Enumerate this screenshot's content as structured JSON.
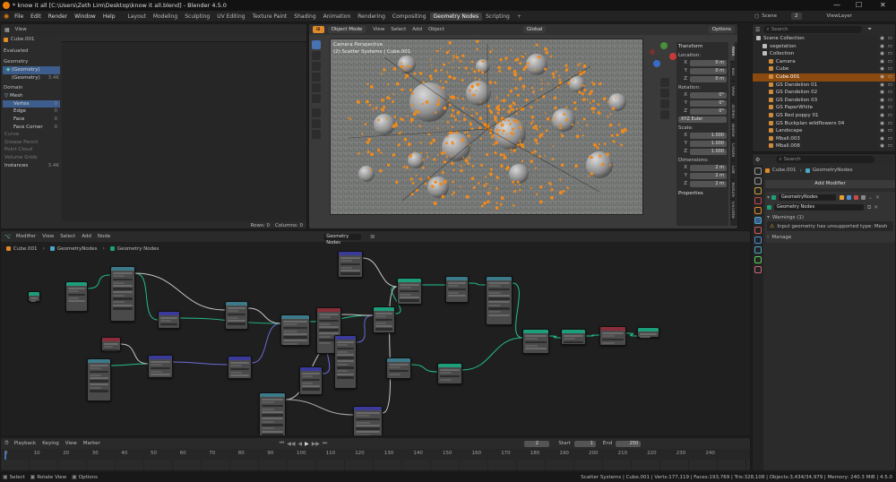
{
  "window": {
    "title": "* know it all [C:\\Users\\Zeth Lim\\Desktop\\know it all.blend] - Blender 4.5.0",
    "controls": [
      "—",
      "☐",
      "✕"
    ]
  },
  "menu": [
    "File",
    "Edit",
    "Render",
    "Window",
    "Help"
  ],
  "workspaces": [
    "Layout",
    "Modeling",
    "Sculpting",
    "UV Editing",
    "Texture Paint",
    "Shading",
    "Animation",
    "Rendering",
    "Compositing",
    "Geometry Nodes",
    "Scripting"
  ],
  "active_workspace": "Geometry Nodes",
  "scene": {
    "label": "Scene",
    "number": "2",
    "view_layer": "ViewLayer"
  },
  "spreadsheet": {
    "header": "View",
    "object": "Cube.001",
    "evaluated": "Evaluated",
    "geometry_heading": "Geometry",
    "geometry_items": [
      {
        "label": "(Geometry)",
        "count": ""
      },
      {
        "label": "(Geometry)",
        "count": "3.4K"
      }
    ],
    "domain_heading": "Domain",
    "mesh_label": "Mesh",
    "mesh_items": [
      {
        "label": "Vertex",
        "count": "0"
      },
      {
        "label": "Edge",
        "count": "0"
      },
      {
        "label": "Face",
        "count": "0"
      },
      {
        "label": "Face Corner",
        "count": "0"
      }
    ],
    "other_items": [
      {
        "label": "Curve",
        "count": ""
      },
      {
        "label": "Grease Pencil",
        "count": ""
      },
      {
        "label": "Point Cloud",
        "count": ""
      },
      {
        "label": "Volume Grids",
        "count": ""
      },
      {
        "label": "Instances",
        "count": "3.4K"
      }
    ],
    "rows": "Rows: 0",
    "columns": "Columns: 0"
  },
  "viewport": {
    "mode": "Object Mode",
    "menus": [
      "View",
      "Select",
      "Add",
      "Object"
    ],
    "orientation": "Global",
    "options": "Options",
    "overlay_title": "Camera Perspective",
    "overlay_sub": "(2) Scatter Systems | Cube.001",
    "transform": {
      "title": "Transform",
      "location": "Location:",
      "loc": [
        {
          "axis": "X",
          "value": "0 m"
        },
        {
          "axis": "Y",
          "value": "0 m"
        },
        {
          "axis": "Z",
          "value": "0 m"
        }
      ],
      "rotation": "Rotation:",
      "rot": [
        {
          "axis": "X",
          "value": "0°"
        },
        {
          "axis": "Y",
          "value": "0°"
        },
        {
          "axis": "Z",
          "value": "0°"
        }
      ],
      "euler": "XYZ Euler",
      "scale": "Scale:",
      "scl": [
        {
          "axis": "X",
          "value": "1.000"
        },
        {
          "axis": "Y",
          "value": "1.000"
        },
        {
          "axis": "Z",
          "value": "1.000"
        }
      ],
      "dimensions": "Dimensions:",
      "dim": [
        {
          "axis": "X",
          "value": "2 m"
        },
        {
          "axis": "Y",
          "value": "2 m"
        },
        {
          "axis": "Z",
          "value": "2 m"
        }
      ],
      "properties": "Properties"
    },
    "side_tabs": [
      "Item",
      "Tool",
      "View",
      "3Dfiles",
      "Biome",
      "Create",
      "Edit",
      "Texture",
      "GScatter"
    ]
  },
  "outliner": {
    "search_placeholder": "Search",
    "rows": [
      {
        "label": "Scene Collection",
        "indent": 0,
        "color": "#bdbdbd",
        "active": false
      },
      {
        "label": "vegetation",
        "indent": 1,
        "color": "#bdbdbd",
        "active": false
      },
      {
        "label": "Collection",
        "indent": 1,
        "color": "#bdbdbd",
        "active": false
      },
      {
        "label": "Camera",
        "indent": 2,
        "color": "#d08a3c",
        "active": false
      },
      {
        "label": "Cube",
        "indent": 2,
        "color": "#d08a3c",
        "active": false
      },
      {
        "label": "Cube.001",
        "indent": 2,
        "color": "#d08a3c",
        "active": true
      },
      {
        "label": "GS Dandelion 01",
        "indent": 2,
        "color": "#d08a3c",
        "active": false
      },
      {
        "label": "GS Dandelion 02",
        "indent": 2,
        "color": "#d08a3c",
        "active": false
      },
      {
        "label": "GS Dandelion 03",
        "indent": 2,
        "color": "#d08a3c",
        "active": false
      },
      {
        "label": "GS PaperWhite",
        "indent": 2,
        "color": "#d08a3c",
        "active": false
      },
      {
        "label": "GS Red poppy 01",
        "indent": 2,
        "color": "#d08a3c",
        "active": false
      },
      {
        "label": "GS Buckplan wildflowers 04",
        "indent": 2,
        "color": "#d08a3c",
        "active": false
      },
      {
        "label": "Landscape",
        "indent": 2,
        "color": "#d08a3c",
        "active": false
      },
      {
        "label": "Mball.003",
        "indent": 2,
        "color": "#d08a3c",
        "active": false
      },
      {
        "label": "Mball.008",
        "indent": 2,
        "color": "#d08a3c",
        "active": false
      }
    ]
  },
  "properties": {
    "search_placeholder": "Search",
    "object": "Cube.001",
    "modifier_path": "GeometryNodes",
    "add_modifier": "Add Modifier",
    "modifier_name": "GeometryNodes",
    "node_group": "Geometry Nodes",
    "warnings_header": "Warnings (1)",
    "warning_text": "Input geometry has unsupported type: Mesh",
    "manage": "Manage"
  },
  "node_editor": {
    "menus": [
      "Modifier",
      "View",
      "Select",
      "Add",
      "Node"
    ],
    "group": "Geometry Nodes",
    "breadcrumb": [
      "Cube.001",
      "GeometryNodes",
      "Geometry Nodes"
    ]
  },
  "timeline": {
    "menus": [
      "Playback",
      "Keying",
      "View",
      "Marker"
    ],
    "current_frame": "2",
    "start_label": "Start",
    "start": "1",
    "end_label": "End",
    "end": "250",
    "ticks": [
      "0",
      "10",
      "20",
      "30",
      "40",
      "50",
      "60",
      "70",
      "80",
      "90",
      "100",
      "110",
      "120",
      "130",
      "140",
      "150",
      "160",
      "170",
      "180",
      "190",
      "200",
      "210",
      "220",
      "230",
      "240"
    ]
  },
  "statusbar": {
    "left": [
      {
        "label": "Select"
      },
      {
        "label": "Rotate View"
      },
      {
        "label": "Options"
      }
    ],
    "right": "Scatter Systems | Cube.001 | Verts:177,119 | Faces:193,769 | Tris:328,108 | Objects:3,434/34,979 | Memory: 240.3 MiB | 4.5.0"
  },
  "colors": {
    "accent": "#4772b3",
    "active_object": "#e0781a",
    "warning": "#e8a030",
    "node_geometry": "#1d9e7a",
    "node_input": "#8a2d3a",
    "node_vector": "#3a3a9a",
    "node_utility": "#3c7a8a"
  }
}
